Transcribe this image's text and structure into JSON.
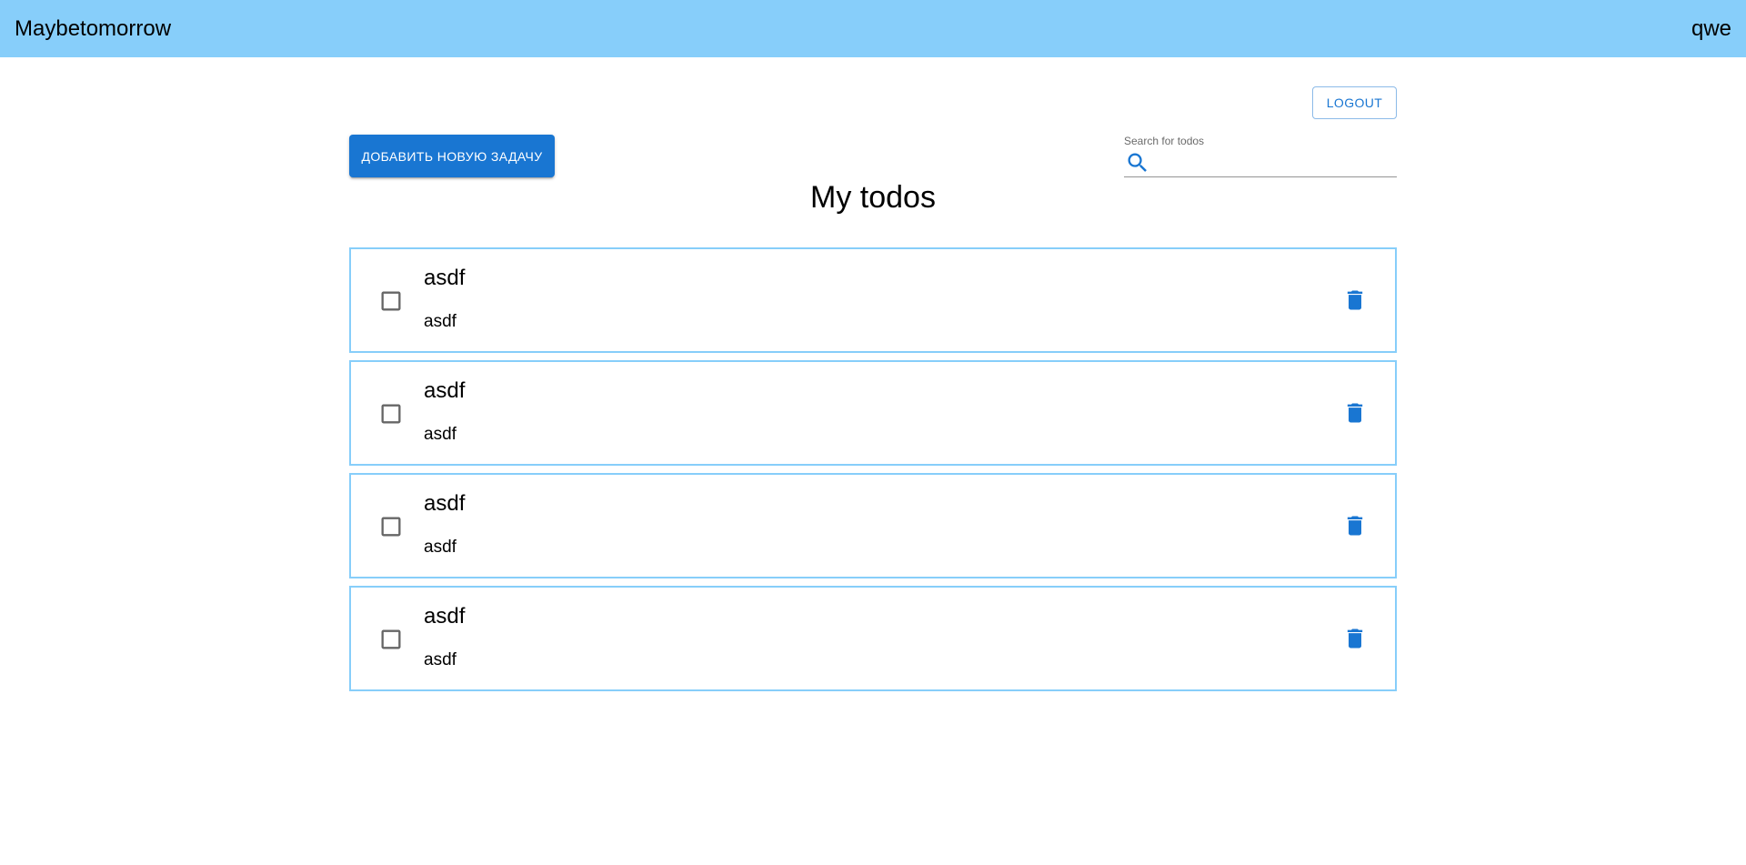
{
  "appbar": {
    "brand": "Maybetomorrow",
    "username": "qwe"
  },
  "toolbar": {
    "logout_label": "LOGOUT",
    "add_label": "ДОБАВИТЬ НОВУЮ ЗАДАЧУ"
  },
  "search": {
    "label": "Search for todos",
    "value": "",
    "icon": "search-icon"
  },
  "main": {
    "title": "My todos"
  },
  "todos": [
    {
      "title": "asdf",
      "description": "asdf",
      "checked": false
    },
    {
      "title": "asdf",
      "description": "asdf",
      "checked": false
    },
    {
      "title": "asdf",
      "description": "asdf",
      "checked": false
    },
    {
      "title": "asdf",
      "description": "asdf",
      "checked": false
    }
  ],
  "colors": {
    "appbar": "#87cefa",
    "primary": "#1976d2",
    "item_border": "#87cefa"
  }
}
